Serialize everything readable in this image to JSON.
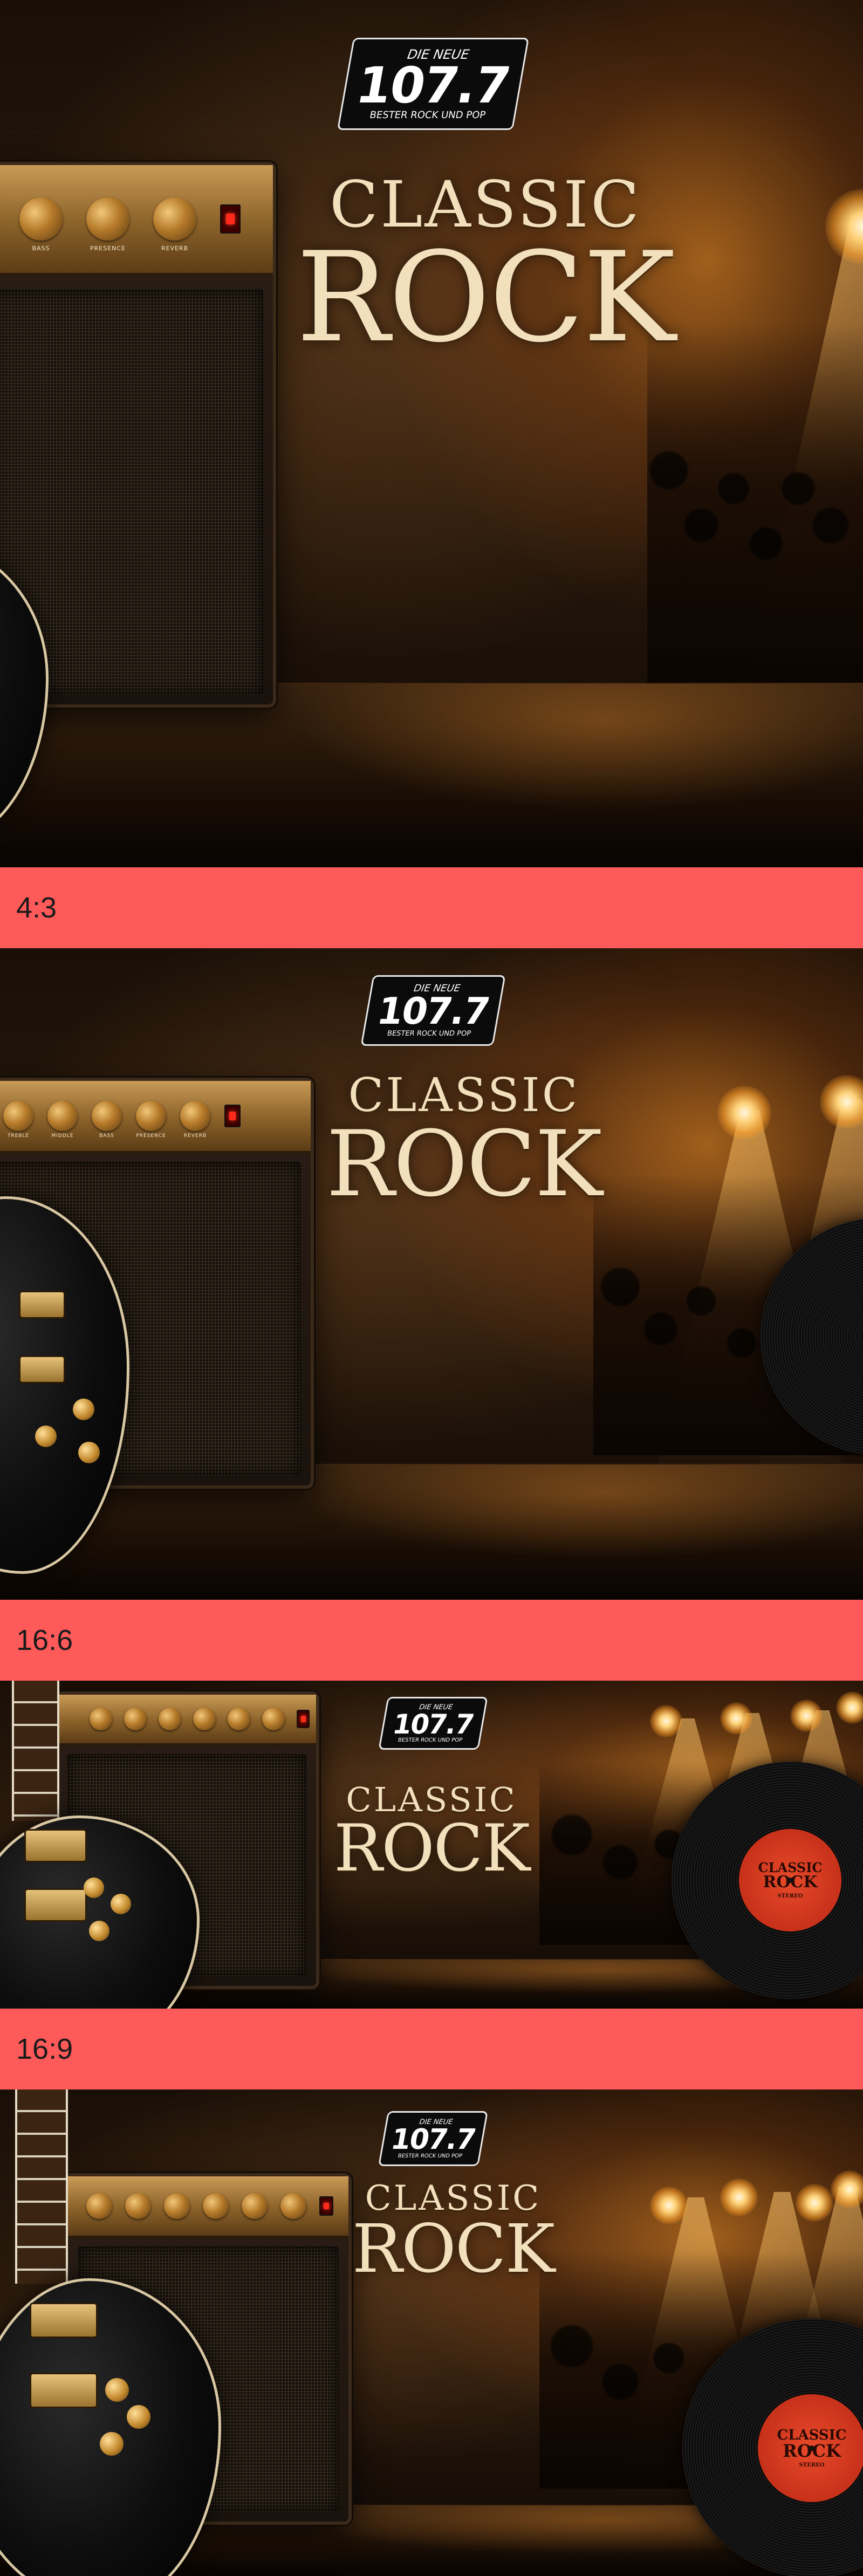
{
  "logo": {
    "top": "DIE NEUE",
    "frequency": "107.7",
    "slogan": "BESTER ROCK UND POP"
  },
  "title": {
    "line1": "CLASSIC",
    "line2": "ROCK"
  },
  "amp": {
    "knobs": [
      "BASS",
      "PRESENCE",
      "REVERB"
    ],
    "knobs_wide": [
      "TREBLE",
      "MIDDLE",
      "BASS",
      "PRESENCE",
      "REVERB"
    ]
  },
  "record": {
    "label_line1": "CLASSIC",
    "label_line2": "ROCK",
    "label_side": "STEREO"
  },
  "formats": [
    "4:3",
    "16:6",
    "16:9"
  ]
}
